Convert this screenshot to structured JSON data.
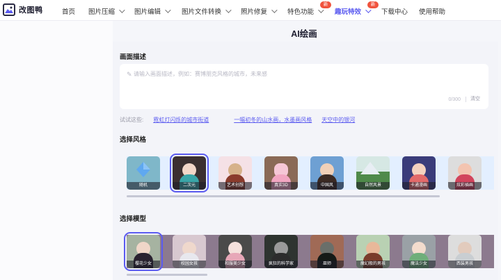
{
  "nav": {
    "logo_text": "改图鸭",
    "items": [
      {
        "label": "首页"
      },
      {
        "label": "图片压缩"
      },
      {
        "label": "图片编辑"
      },
      {
        "label": "图片文件转换"
      },
      {
        "label": "照片修复"
      },
      {
        "label": "特色功能"
      },
      {
        "label": "趣玩特效"
      },
      {
        "label": "下载中心"
      },
      {
        "label": "使用帮助"
      }
    ],
    "badges": {
      "feature": "新",
      "fun": "新"
    },
    "active_color": "#5b5bf0"
  },
  "page": {
    "title": "AI绘画"
  },
  "prompt": {
    "section_title": "画面描述",
    "placeholder": "请输入画面描述，例如：赛博朋克风格的城市，未来感",
    "counter": "0/300",
    "clear_label": "清空",
    "try_label": "试试这些:",
    "suggestions": [
      "霓虹灯闪烁的城市街道",
      "一幅初冬的山水画，水墨画风格",
      "天空中的银河"
    ]
  },
  "style": {
    "section_title": "选择风格",
    "items": [
      {
        "label": "随机",
        "bg": "#e3efff"
      },
      {
        "label": "二次元",
        "bg": "#7fb7c9"
      },
      {
        "label": "艺术创想",
        "bg": "#3b3030"
      },
      {
        "label": "真实3D",
        "bg": "#f5e1e6"
      },
      {
        "label": "中国风",
        "bg": "#8a6a56"
      },
      {
        "label": "自然风景",
        "bg": "#6ea0d3"
      },
      {
        "label": "卡通漫画",
        "bg": "#d6e8e4"
      },
      {
        "label": "炫彩插画",
        "bg": "#3a3c7a"
      }
    ]
  },
  "model": {
    "section_title": "选择模型",
    "items": [
      {
        "label": "樱花少女",
        "bg": "#8c7a8e"
      },
      {
        "label": "校园女孩",
        "bg": "#a6b3a1"
      },
      {
        "label": "和服美少女",
        "bg": "#d8c8d0"
      },
      {
        "label": "疯狂的科学家",
        "bg": "#4a4a4a"
      },
      {
        "label": "巫师",
        "bg": "#2e3430"
      },
      {
        "label": "魔幻般的男孩",
        "bg": "#a06a56"
      },
      {
        "label": "魔法少女",
        "bg": "#b9d1b3"
      },
      {
        "label": "西装男孩",
        "bg": "#9aa1a6"
      }
    ]
  }
}
